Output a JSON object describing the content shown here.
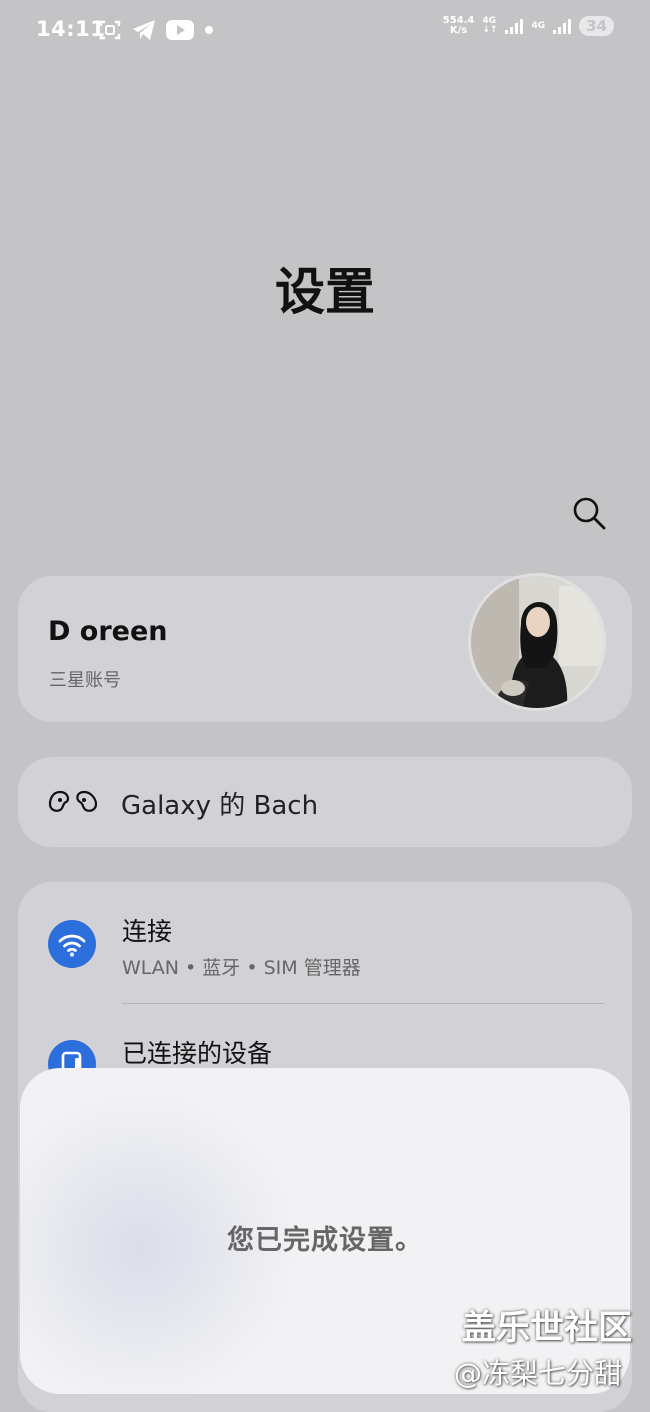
{
  "status_bar": {
    "time": "14:11",
    "net_speed_value": "554.4",
    "net_speed_unit": "K/s",
    "network_1": "4G",
    "network_2": "4G",
    "battery": "34",
    "left_icons": [
      "screenshot-icon",
      "telegram-icon",
      "youtube-icon",
      "notification-dot-icon"
    ]
  },
  "page": {
    "title": "设置"
  },
  "account": {
    "name": "D oreen",
    "subtitle": "三星账号"
  },
  "galaxy": {
    "label": "Galaxy 的 Bach"
  },
  "settings_items": [
    {
      "title": "连接",
      "subtitle": "WLAN • 蓝牙 • SIM 管理器",
      "icon": "wifi-icon"
    },
    {
      "title": "已连接的设备",
      "icon": "connected-devices-icon"
    }
  ],
  "dialog": {
    "message": "您已完成设置。"
  },
  "watermark": {
    "line1": "盖乐世社区",
    "line2": "@冻梨七分甜"
  },
  "colors": {
    "background": "#c4c4c6",
    "card": "#d2d2d6",
    "accent": "#2c6fdc",
    "dialog": "#f2f2f4"
  }
}
